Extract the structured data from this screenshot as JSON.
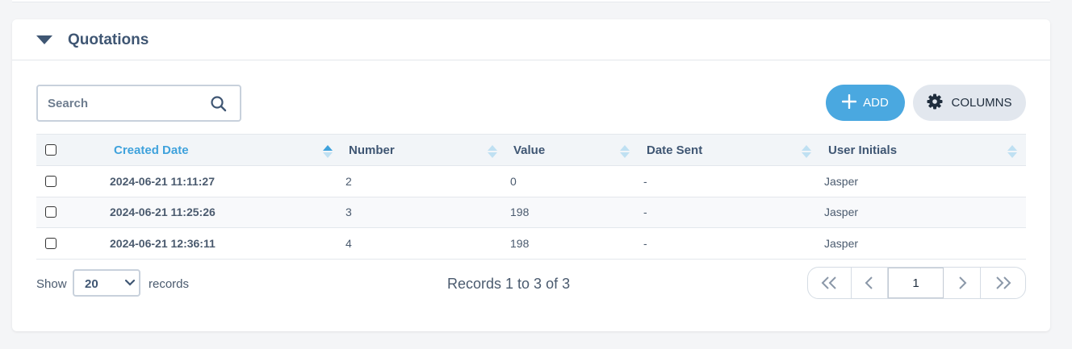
{
  "card": {
    "title": "Quotations"
  },
  "search": {
    "placeholder": "Search",
    "value": ""
  },
  "toolbar": {
    "add_label": "ADD",
    "columns_label": "COLUMNS"
  },
  "table": {
    "headers": [
      "Created Date",
      "Number",
      "Value",
      "Date Sent",
      "User Initials"
    ],
    "sorted_column": "Created Date",
    "rows": [
      {
        "created": "2024-06-21 11:11:27",
        "number": "2",
        "value": "0",
        "sent": "-",
        "user": "Jasper"
      },
      {
        "created": "2024-06-21 11:25:26",
        "number": "3",
        "value": "198",
        "sent": "-",
        "user": "Jasper"
      },
      {
        "created": "2024-06-21 12:36:11",
        "number": "4",
        "value": "198",
        "sent": "-",
        "user": "Jasper"
      }
    ]
  },
  "footer": {
    "show_label": "Show",
    "page_size": "20",
    "records_label": "records",
    "records_info": "Records 1 to 3 of 3",
    "current_page": "1"
  },
  "colors": {
    "accent": "#4aa8e0",
    "title": "#3f5673",
    "sort_active": "#3fa2dc"
  },
  "icons": [
    "caret-down-icon",
    "search-icon",
    "plus-icon",
    "gear-icon",
    "sort-icon",
    "chevron-down-icon",
    "first-page-icon",
    "prev-page-icon",
    "next-page-icon",
    "last-page-icon"
  ]
}
